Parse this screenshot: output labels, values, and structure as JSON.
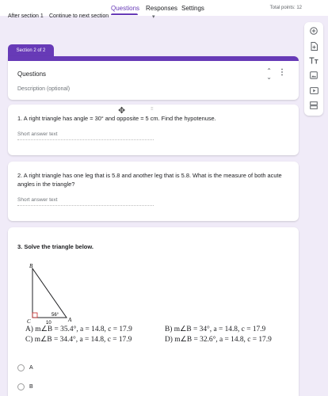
{
  "nav": {
    "tabs": [
      {
        "label": "Questions"
      },
      {
        "label": "Responses"
      },
      {
        "label": "Settings"
      }
    ],
    "total_points": "Total points: 12"
  },
  "after_section": {
    "label": "After section 1",
    "value": "Continue to next section"
  },
  "section": {
    "tab_label": "Section 2 of 2",
    "title": "Questions",
    "description_placeholder": "Description (optional)"
  },
  "questions": [
    {
      "text": "1.  A right triangle has angle = 30° and opposite = 5 cm. Find the hypotenuse.",
      "answer_placeholder": "Short answer text"
    },
    {
      "text": "2.  A right triangle has one leg that is 5.8 and another leg that is 5.8.  What is the measure of both acute angles in the triangle?",
      "answer_placeholder": "Short answer text"
    }
  ],
  "question3": {
    "title": "3. Solve the triangle below.",
    "figure": {
      "vertex_b": "B",
      "vertex_c": "C",
      "vertex_a": "A",
      "angle": "56°",
      "side": "10"
    },
    "choices": [
      "A)  m∠B = 35.4°,  a = 14.8,  c = 17.9",
      "B)  m∠B = 34°,  a = 14.8,  c = 17.9",
      "C)  m∠B = 34.4°,  a = 14.8,  c = 17.9",
      "D)  m∠B = 32.6°,  a = 14.8,  c = 17.9"
    ],
    "options": [
      "A",
      "B"
    ]
  },
  "colors": {
    "accent": "#673ab7",
    "background": "#f0ebf8"
  },
  "toolbar_icons": [
    "add-question-icon",
    "import-questions-icon",
    "add-title-icon",
    "add-image-icon",
    "add-video-icon",
    "add-section-icon"
  ]
}
